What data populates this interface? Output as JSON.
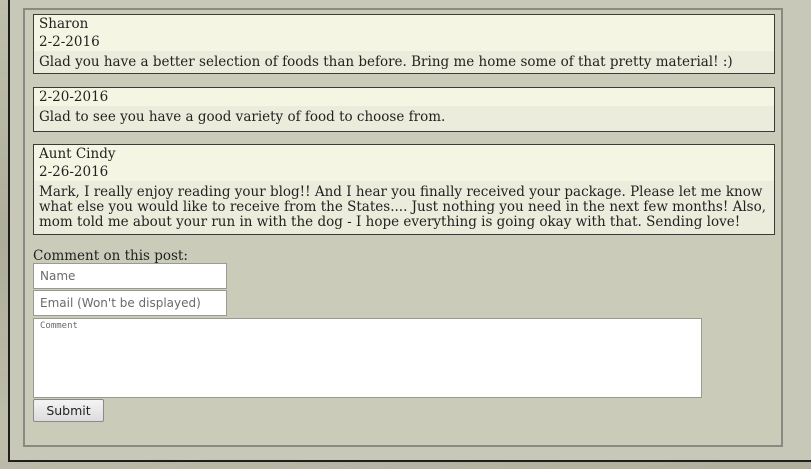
{
  "comments": [
    {
      "author": "Sharon",
      "date": "2-2-2016",
      "text": "Glad you have a better selection of foods than before. Bring me home some of that pretty material! :)"
    },
    {
      "author": "",
      "date": "2-20-2016",
      "text": "Glad to see you have a good variety of food to choose from."
    },
    {
      "author": "Aunt Cindy",
      "date": "2-26-2016",
      "text": "Mark, I really enjoy reading your blog!!  And I hear you finally received your package.  Please let me know what else you would like to receive from the States.... Just nothing you need in the next few months!  Also, mom told me about your run in with the dog - I hope everything is going okay with that.  Sending love!"
    }
  ],
  "form": {
    "label": "Comment on this post:",
    "name_placeholder": "Name",
    "email_placeholder": "Email (Won't be displayed)",
    "comment_placeholder": "Comment",
    "submit_label": "Submit"
  }
}
